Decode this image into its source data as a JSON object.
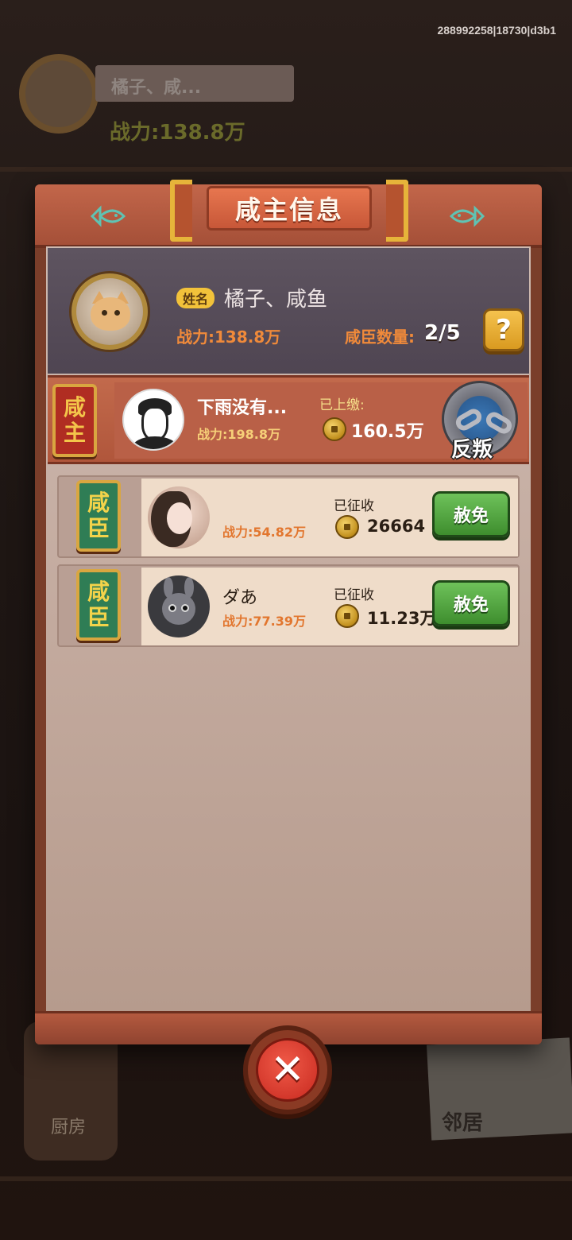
{
  "build_id": "288992258|18730|d3b1",
  "background": {
    "player_name": "橘子、咸...",
    "player_power": "战力:138.8万",
    "kitchen_label": "厨房",
    "neighbor_label": "邻居"
  },
  "modal": {
    "title": "咸主信息",
    "lord": {
      "name_badge": "姓名",
      "name": "橘子、咸鱼",
      "power": "战力:138.8万",
      "vassal_count_label": "咸臣数量:",
      "vassal_count_value": "2/5",
      "help_label": "?"
    },
    "overlord": {
      "plaque_line1": "咸",
      "plaque_line2": "主",
      "name": "下雨没有...",
      "power": "战力:198.8万",
      "paid_label": "已上缴:",
      "paid_value": "160.5万",
      "rebel_label": "反叛"
    },
    "vassals": [
      {
        "plaque_line1": "咸",
        "plaque_line2": "臣",
        "name": "",
        "power": "战力:54.82万",
        "taxed_label": "已征收",
        "taxed_value": "26664",
        "pardon_label": "赦免"
      },
      {
        "plaque_line1": "咸",
        "plaque_line2": "臣",
        "name": "ダあ",
        "power": "战力:77.39万",
        "taxed_label": "已征收",
        "taxed_value": "11.23万",
        "pardon_label": "赦免"
      }
    ],
    "close_label": "✕"
  },
  "colors": {
    "frame": "#7a3e2a",
    "accent_orange": "#f08a3a",
    "pardon_green": "#3e8e2e",
    "close_red": "#c7291f"
  }
}
